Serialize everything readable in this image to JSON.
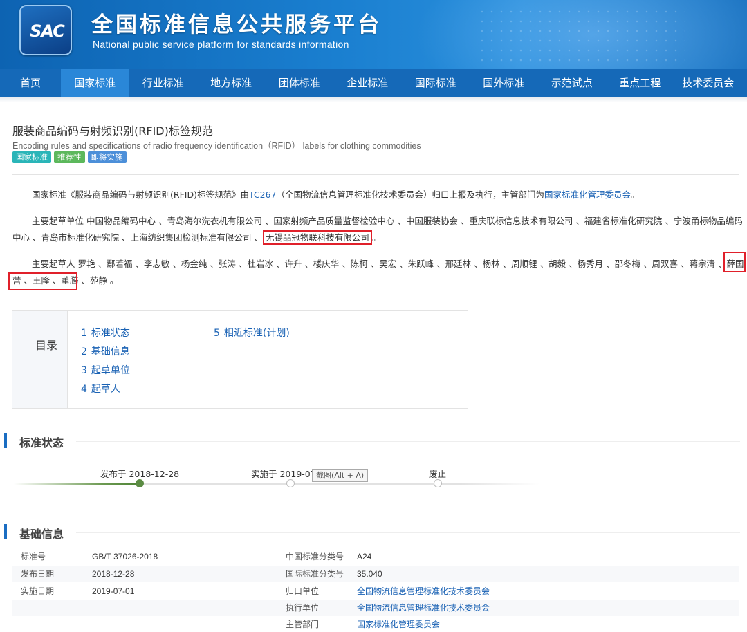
{
  "header": {
    "logo_text": "SAC",
    "title": "全国标准信息公共服务平台",
    "subtitle": "National public service platform  for standards information"
  },
  "nav": {
    "items": [
      "首页",
      "国家标准",
      "行业标准",
      "地方标准",
      "团体标准",
      "企业标准",
      "国际标准",
      "国外标准",
      "示范试点",
      "重点工程",
      "技术委员会"
    ],
    "active": "国家标准"
  },
  "standard": {
    "title": "服装商品编码与射频识别(RFID)标签规范",
    "title_en": "Encoding rules and specifications of radio frequency identification（RFID） labels for clothing commodities",
    "tags": [
      "国家标准",
      "推荐性",
      "即将实施"
    ]
  },
  "intro": {
    "p1_a": "国家标准《服装商品编码与射频识别(RFID)标签规范》由",
    "p1_tc_link": "TC267",
    "p1_b": "（全国物流信息管理标准化技术委员会）归口上报及执行，主管部门为",
    "p1_dept_link": "国家标准化管理委员会",
    "p1_c": "。",
    "p2_a": "主要起草单位 中国物品编码中心 、青岛海尔洗衣机有限公司 、国家射频产品质量监督检验中心 、中国服装协会 、重庆联标信息技术有限公司 、福建省标准化研究院 、宁波甬标物品编码中心 、青岛市标准化研究院 、上海纺织集团检测标准有限公司 、",
    "p2_highlight": "无锡品冠物联科技有限公司",
    "p2_b": "。",
    "p3_a": "主要起草人 罗艳 、鄢若福 、李志敏 、杨金纯 、张涛 、杜岩冰 、许升 、楼庆华 、陈柯 、吴宏 、朱跃峰 、邢廷林 、杨林 、周顺锂 、胡毅 、杨秀月 、邵冬梅 、周双喜 、",
    "p3_highlight": "蒋宗清 、薛国营",
    "p3_b": " 、王隆 、董腾 、苑静 。"
  },
  "toc": {
    "label": "目录",
    "items": [
      {
        "num": "1",
        "text": "标准状态"
      },
      {
        "num": "2",
        "text": "基础信息"
      },
      {
        "num": "3",
        "text": "起草单位"
      },
      {
        "num": "4",
        "text": "起草人"
      },
      {
        "num": "5",
        "text": "相近标准(计划)"
      }
    ]
  },
  "status_section": {
    "title": "标准状态",
    "milestones": [
      {
        "label": "发布于 2018-12-28",
        "reached": true
      },
      {
        "label": "实施于 2019-07-01",
        "reached": false
      },
      {
        "label": "废止",
        "reached": false
      }
    ],
    "tooltip": "截图(Alt + A)"
  },
  "info_section": {
    "title": "基础信息",
    "rows": [
      {
        "k1": "标准号",
        "v1": "GB/T 37026-2018",
        "k2": "中国标准分类号",
        "v2": "A24"
      },
      {
        "k1": "发布日期",
        "v1": "2018-12-28",
        "k2": "国际标准分类号",
        "v2": "35.040"
      },
      {
        "k1": "实施日期",
        "v1": "2019-07-01",
        "k2": "归口单位",
        "v2": "全国物流信息管理标准化技术委员会"
      },
      {
        "k1": "",
        "v1": "",
        "k2": "执行单位",
        "v2": "全国物流信息管理标准化技术委员会"
      },
      {
        "k1": "",
        "v1": "",
        "k2": "主管部门",
        "v2": "国家标准化管理委员会"
      }
    ]
  },
  "colors": {
    "banner": "#1a7fd0",
    "nav": "#1569b8",
    "nav_active": "#2a87d8",
    "link": "#1a62b4",
    "highlight_box": "#e0202a",
    "timeline_done": "#5b8b43"
  }
}
